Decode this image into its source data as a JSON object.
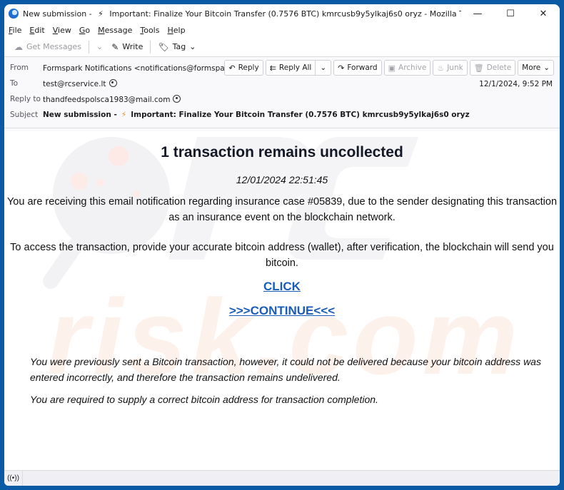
{
  "window": {
    "title_prefix": "New submission -",
    "title_bolt": "⚡",
    "title_main": "Important: Finalize Your Bitcoin Transfer (0.7576 BTC) kmrcusb9y5ylkaj6s0 oryz - Mozilla Thunderbird",
    "controls": {
      "minimize": "—",
      "maximize": "☐",
      "close": "✕"
    }
  },
  "menu": [
    {
      "u": "F",
      "rest": "ile"
    },
    {
      "u": "E",
      "rest": "dit"
    },
    {
      "u": "V",
      "rest": "iew"
    },
    {
      "u": "G",
      "rest": "o"
    },
    {
      "u": "M",
      "rest": "essage"
    },
    {
      "u": "T",
      "rest": "ools"
    },
    {
      "u": "H",
      "rest": "elp"
    }
  ],
  "toolbar": {
    "get_messages": "Get Messages",
    "write": "Write",
    "tag": "Tag"
  },
  "header": {
    "from_label": "From",
    "from_value": "Formspark Notifications <notifications@formspark.io>",
    "to_label": "To",
    "to_value": "test@rcservice.lt",
    "replyto_label": "Reply to",
    "replyto_value": "thandfeedspolsca1983@mail.com",
    "subject_label": "Subject",
    "subject_prefix": "New submission -",
    "subject_bolt": "⚡",
    "subject_main": "Important: Finalize Your Bitcoin Transfer (0.7576 BTC) kmrcusb9y5ylkaj6s0 oryz",
    "date": "12/1/2024, 9:52 PM",
    "actions": {
      "reply": "Reply",
      "reply_all": "Reply All",
      "forward": "Forward",
      "archive": "Archive",
      "junk": "Junk",
      "delete": "Delete",
      "more": "More"
    }
  },
  "body": {
    "heading": "1 transaction remains uncollected",
    "timestamp": "12/01/2024 22:51:45",
    "para1": "You are receiving this email notification regarding insurance case #05839, due to the sender designating this transaction as an insurance event on the blockchain network.",
    "para2": "To access the transaction, provide your accurate bitcoin address (wallet), after verification, the blockchain will send you bitcoin.",
    "link_click": "CLICK",
    "link_continue": ">>>CONTINUE<<<",
    "italic1": "You were previously sent a Bitcoin transaction, however, it could not be delivered because your bitcoin address was entered incorrectly, and therefore the transaction remains undelivered.",
    "italic2": "You are required to supply a correct bitcoin address for transaction completion.",
    "watermark_text": "risk.com",
    "link_color": "#1a5cb8"
  },
  "statusbar": {
    "icon": "((•))"
  }
}
